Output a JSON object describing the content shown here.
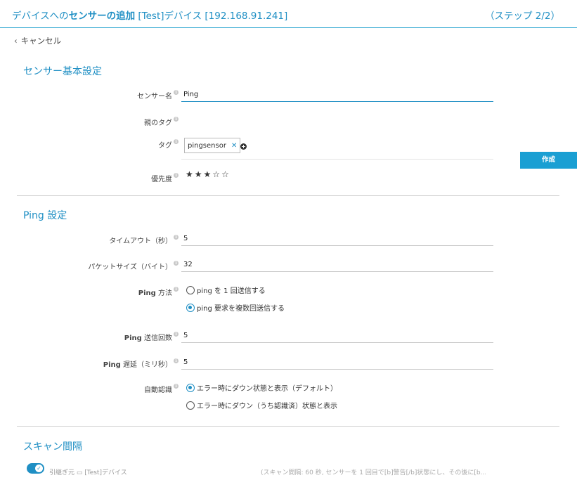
{
  "header": {
    "title_prefix": "デバイスへの",
    "title_bold": "センサーの追加",
    "title_suffix": " [Test]デバイス [192.168.91.241]",
    "step": "（ステップ 2/2）"
  },
  "nav": {
    "cancel_label": "キャンセル"
  },
  "basic": {
    "section_title": "センサー基本設定",
    "sensor_name_label": "センサー名",
    "sensor_name_value": "Ping",
    "parent_tags_label": "親のタグ",
    "tags_label": "タグ",
    "tags": [
      "pingsensor"
    ],
    "priority_label": "優先度",
    "priority": {
      "stars_filled": 3,
      "stars_total": 5
    }
  },
  "actions": {
    "create_label": "作成"
  },
  "ping": {
    "section_title": "Ping 設定",
    "timeout_label": "タイムアウト（秒）",
    "timeout_value": "5",
    "packet_size_label": "パケットサイズ（バイト）",
    "packet_size_value": "32",
    "method_label_kw": "Ping",
    "method_label_rest": " 方法",
    "method_options": [
      "ping を 1 回送信する",
      "ping 要求を複数回送信する"
    ],
    "method_selected": 1,
    "count_label_kw": "Ping",
    "count_label_rest": " 送信回数",
    "count_value": "5",
    "delay_label_kw": "Ping",
    "delay_label_rest": " 遅延（ミリ秒）",
    "delay_value": "5",
    "ack_label": "自動認識",
    "ack_options": [
      "エラー時にダウン状態と表示（デフォルト）",
      "エラー時にダウン（うち認識済）状態と表示"
    ],
    "ack_selected": 0
  },
  "scan": {
    "section_title": "スキャン間隔",
    "inherit_label": "引継ぎ元 ▭ [Test]デバイス",
    "inherit_on": true,
    "note": "(スキャン間隔: 60 秒, センサーを 1 回目で[b]警告[/b]状態にし、その後に[b...)"
  }
}
